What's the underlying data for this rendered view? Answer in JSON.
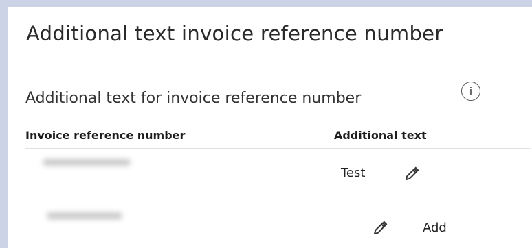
{
  "panel": {
    "title": "Additional text invoice reference number",
    "subtitle": "Additional text for invoice reference number",
    "info_icon_glyph": "i"
  },
  "table": {
    "headers": {
      "reference": "Invoice reference number",
      "additional_text": "Additional text"
    },
    "rows": [
      {
        "reference_hidden": true,
        "additional_text": "Test",
        "action_icon": "pencil-icon"
      },
      {
        "reference_hidden": true,
        "additional_text": "",
        "action_icon": "pencil-icon",
        "action_label": "Add"
      }
    ]
  },
  "colors": {
    "background": "#cdd3e6",
    "card": "#ffffff",
    "divider": "#e1e1e1"
  }
}
